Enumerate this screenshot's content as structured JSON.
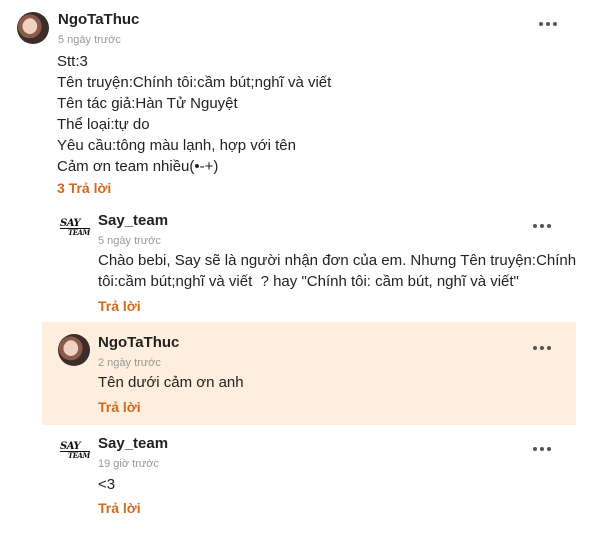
{
  "comment": {
    "author": "NgoTaThuc",
    "time": "5 ngày trước",
    "lines": [
      "Stt:3",
      "Tên truyện:Chính tôi:cầm bút;nghĩ và viết",
      "Tên tác giả:Hàn Tử Nguyệt",
      "Thể loại:tự do",
      "Yêu cầu:tông màu lạnh, hợp với tên",
      "Cảm ơn team nhiều(•-+)"
    ],
    "replies_link": "3 Trả lời"
  },
  "replies": [
    {
      "author": "Say_team",
      "time": "5 ngày trước",
      "lines": [
        "Chào bebi, Say sẽ là người nhận đơn của em. Nhưng Tên truyện:Chính",
        "tôi:cầm bút;nghĩ và viết  ? hay \"Chính tôi: cầm bút, nghĩ và viết\""
      ],
      "reply_label": "Trả lời"
    },
    {
      "author": "NgoTaThuc",
      "time": "2 ngày trước",
      "lines": [
        "Tên dưới cảm ơn anh"
      ],
      "reply_label": "Trả lời"
    },
    {
      "author": "Say_team",
      "time": "19 giờ trước",
      "lines": [
        "<3"
      ],
      "reply_label": "Trả lời"
    }
  ],
  "logo": {
    "line1": "SAY",
    "line2": "TEAM"
  },
  "colors": {
    "accent": "#d2691e",
    "highlight_bg": "#fdeedd",
    "muted": "#999999"
  },
  "icons": {
    "more": "more-horizontal-icon"
  }
}
